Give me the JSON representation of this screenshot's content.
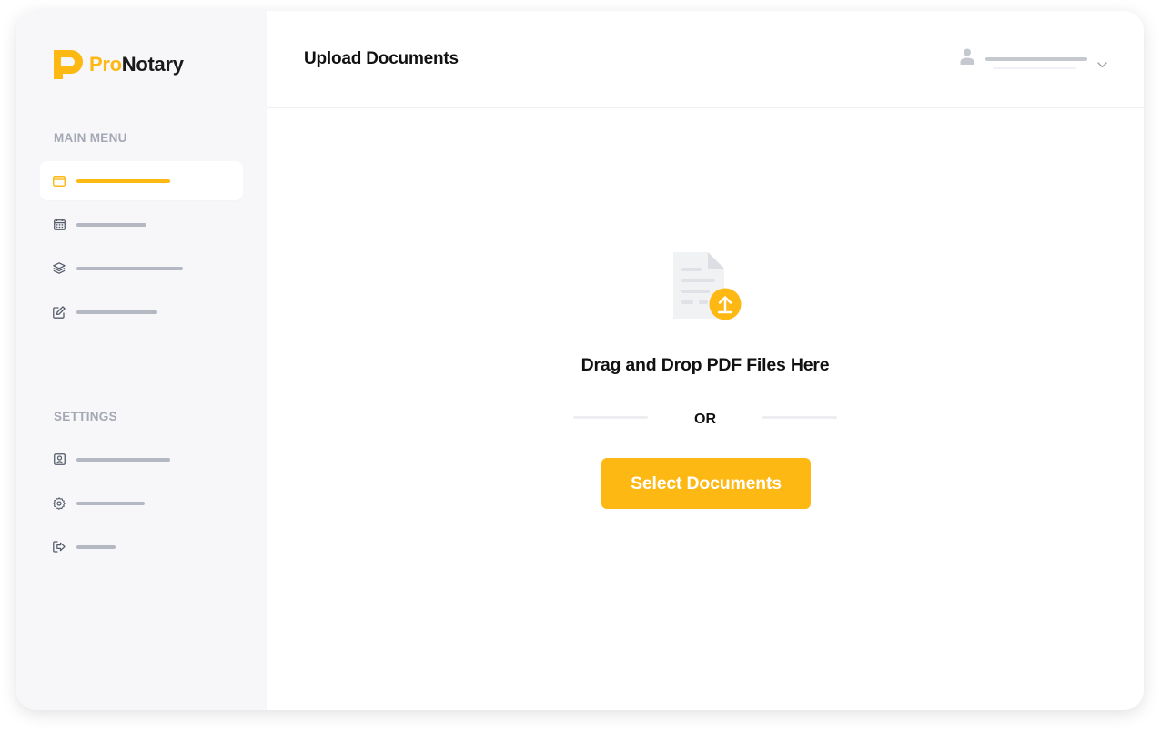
{
  "app": {
    "brand_prefix": "Pro",
    "brand_suffix": "Notary"
  },
  "colors": {
    "accent": "#FDB813",
    "sidebar_bg": "#f7f7f9",
    "muted_text": "#a3a8b4",
    "placeholder_bar": "#b4b8c2"
  },
  "sidebar": {
    "main_menu_label": "MAIN MENU",
    "settings_label": "SETTINGS",
    "main_items": [
      {
        "icon": "browser-window-icon",
        "active": true
      },
      {
        "icon": "calendar-icon",
        "active": false
      },
      {
        "icon": "layers-icon",
        "active": false
      },
      {
        "icon": "edit-icon",
        "active": false
      }
    ],
    "settings_items": [
      {
        "icon": "profile-card-icon",
        "active": false
      },
      {
        "icon": "gear-icon",
        "active": false
      },
      {
        "icon": "logout-icon",
        "active": false
      }
    ]
  },
  "header": {
    "title": "Upload Documents",
    "user_icon": "user-icon",
    "dropdown_icon": "chevron-down-icon"
  },
  "upload": {
    "illustration_icon": "document-upload-icon",
    "drop_text": "Drag and Drop PDF Files Here",
    "or_text": "OR",
    "select_button": "Select Documents"
  }
}
